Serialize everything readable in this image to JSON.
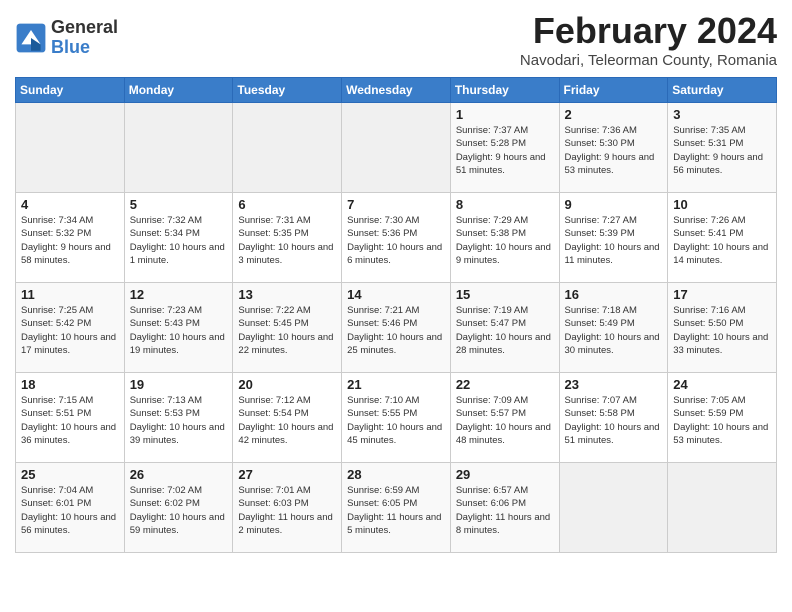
{
  "logo": {
    "general": "General",
    "blue": "Blue"
  },
  "title": "February 2024",
  "location": "Navodari, Teleorman County, Romania",
  "days_of_week": [
    "Sunday",
    "Monday",
    "Tuesday",
    "Wednesday",
    "Thursday",
    "Friday",
    "Saturday"
  ],
  "weeks": [
    [
      {
        "day": "",
        "info": ""
      },
      {
        "day": "",
        "info": ""
      },
      {
        "day": "",
        "info": ""
      },
      {
        "day": "",
        "info": ""
      },
      {
        "day": "1",
        "info": "Sunrise: 7:37 AM\nSunset: 5:28 PM\nDaylight: 9 hours and 51 minutes."
      },
      {
        "day": "2",
        "info": "Sunrise: 7:36 AM\nSunset: 5:30 PM\nDaylight: 9 hours and 53 minutes."
      },
      {
        "day": "3",
        "info": "Sunrise: 7:35 AM\nSunset: 5:31 PM\nDaylight: 9 hours and 56 minutes."
      }
    ],
    [
      {
        "day": "4",
        "info": "Sunrise: 7:34 AM\nSunset: 5:32 PM\nDaylight: 9 hours and 58 minutes."
      },
      {
        "day": "5",
        "info": "Sunrise: 7:32 AM\nSunset: 5:34 PM\nDaylight: 10 hours and 1 minute."
      },
      {
        "day": "6",
        "info": "Sunrise: 7:31 AM\nSunset: 5:35 PM\nDaylight: 10 hours and 3 minutes."
      },
      {
        "day": "7",
        "info": "Sunrise: 7:30 AM\nSunset: 5:36 PM\nDaylight: 10 hours and 6 minutes."
      },
      {
        "day": "8",
        "info": "Sunrise: 7:29 AM\nSunset: 5:38 PM\nDaylight: 10 hours and 9 minutes."
      },
      {
        "day": "9",
        "info": "Sunrise: 7:27 AM\nSunset: 5:39 PM\nDaylight: 10 hours and 11 minutes."
      },
      {
        "day": "10",
        "info": "Sunrise: 7:26 AM\nSunset: 5:41 PM\nDaylight: 10 hours and 14 minutes."
      }
    ],
    [
      {
        "day": "11",
        "info": "Sunrise: 7:25 AM\nSunset: 5:42 PM\nDaylight: 10 hours and 17 minutes."
      },
      {
        "day": "12",
        "info": "Sunrise: 7:23 AM\nSunset: 5:43 PM\nDaylight: 10 hours and 19 minutes."
      },
      {
        "day": "13",
        "info": "Sunrise: 7:22 AM\nSunset: 5:45 PM\nDaylight: 10 hours and 22 minutes."
      },
      {
        "day": "14",
        "info": "Sunrise: 7:21 AM\nSunset: 5:46 PM\nDaylight: 10 hours and 25 minutes."
      },
      {
        "day": "15",
        "info": "Sunrise: 7:19 AM\nSunset: 5:47 PM\nDaylight: 10 hours and 28 minutes."
      },
      {
        "day": "16",
        "info": "Sunrise: 7:18 AM\nSunset: 5:49 PM\nDaylight: 10 hours and 30 minutes."
      },
      {
        "day": "17",
        "info": "Sunrise: 7:16 AM\nSunset: 5:50 PM\nDaylight: 10 hours and 33 minutes."
      }
    ],
    [
      {
        "day": "18",
        "info": "Sunrise: 7:15 AM\nSunset: 5:51 PM\nDaylight: 10 hours and 36 minutes."
      },
      {
        "day": "19",
        "info": "Sunrise: 7:13 AM\nSunset: 5:53 PM\nDaylight: 10 hours and 39 minutes."
      },
      {
        "day": "20",
        "info": "Sunrise: 7:12 AM\nSunset: 5:54 PM\nDaylight: 10 hours and 42 minutes."
      },
      {
        "day": "21",
        "info": "Sunrise: 7:10 AM\nSunset: 5:55 PM\nDaylight: 10 hours and 45 minutes."
      },
      {
        "day": "22",
        "info": "Sunrise: 7:09 AM\nSunset: 5:57 PM\nDaylight: 10 hours and 48 minutes."
      },
      {
        "day": "23",
        "info": "Sunrise: 7:07 AM\nSunset: 5:58 PM\nDaylight: 10 hours and 51 minutes."
      },
      {
        "day": "24",
        "info": "Sunrise: 7:05 AM\nSunset: 5:59 PM\nDaylight: 10 hours and 53 minutes."
      }
    ],
    [
      {
        "day": "25",
        "info": "Sunrise: 7:04 AM\nSunset: 6:01 PM\nDaylight: 10 hours and 56 minutes."
      },
      {
        "day": "26",
        "info": "Sunrise: 7:02 AM\nSunset: 6:02 PM\nDaylight: 10 hours and 59 minutes."
      },
      {
        "day": "27",
        "info": "Sunrise: 7:01 AM\nSunset: 6:03 PM\nDaylight: 11 hours and 2 minutes."
      },
      {
        "day": "28",
        "info": "Sunrise: 6:59 AM\nSunset: 6:05 PM\nDaylight: 11 hours and 5 minutes."
      },
      {
        "day": "29",
        "info": "Sunrise: 6:57 AM\nSunset: 6:06 PM\nDaylight: 11 hours and 8 minutes."
      },
      {
        "day": "",
        "info": ""
      },
      {
        "day": "",
        "info": ""
      }
    ]
  ]
}
